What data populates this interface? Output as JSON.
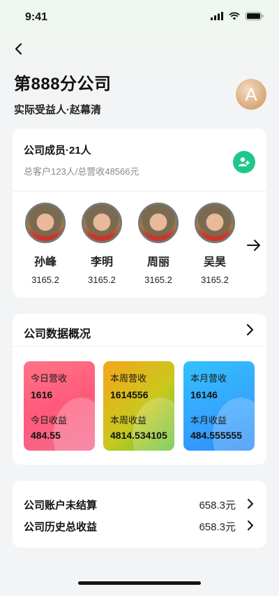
{
  "status": {
    "time": "9:41"
  },
  "header": {
    "title": "第888分公司",
    "subtitle": "实际受益人·赵幕清",
    "avatar_letter": "A"
  },
  "members_card": {
    "title": "公司成员·21人",
    "stats": "总客户123人/总营收48566元",
    "members": [
      {
        "name": "孙峰",
        "value": "3165.2"
      },
      {
        "name": "李明",
        "value": "3165.2"
      },
      {
        "name": "周丽",
        "value": "3165.2"
      },
      {
        "name": "吴昊",
        "value": "3165.2"
      }
    ]
  },
  "overview_card": {
    "title": "公司数据概况",
    "tiles": [
      {
        "label1": "今日营收",
        "value1": "1616",
        "label2": "今日收益",
        "value2": "484.55",
        "color": "#ff5a7a"
      },
      {
        "label1": "本周营收",
        "value1": "1614556",
        "label2": "本周收益",
        "value2": "4814.534105",
        "color": "#c9c81e"
      },
      {
        "label1": "本月营收",
        "value1": "16146",
        "label2": "本月收益",
        "value2": "484.555555",
        "color": "#36a2ff"
      }
    ]
  },
  "account_card": {
    "rows": [
      {
        "label": "公司账户未结算",
        "value": "658.3元"
      },
      {
        "label": "公司历史总收益",
        "value": "658.3元"
      }
    ]
  },
  "icons": [
    "back-arrow-icon",
    "add-user-icon",
    "arrow-right-icon",
    "chevron-right-icon"
  ],
  "colors": {
    "accent_green": "#1ec88a"
  }
}
